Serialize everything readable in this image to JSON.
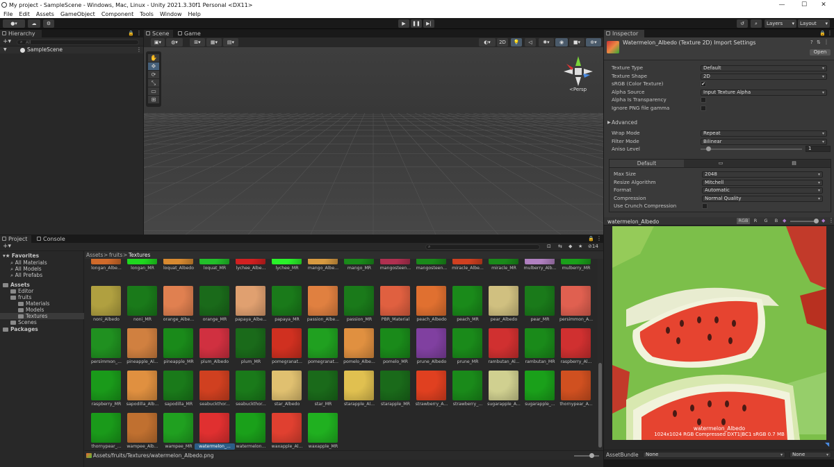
{
  "window": {
    "title": "My project - SampleScene - Windows, Mac, Linux - Unity 2021.3.30f1 Personal <DX11>",
    "minimize": "—",
    "maximize": "☐",
    "close": "✕"
  },
  "menu": [
    "File",
    "Edit",
    "Assets",
    "GameObject",
    "Component",
    "Tools",
    "Window",
    "Help"
  ],
  "toolbar": {
    "layers_label": "Layers",
    "layout_label": "Layout"
  },
  "hierarchy": {
    "tab": "Hierarchy",
    "search_placeholder": "All",
    "scene": "SampleScene"
  },
  "scene_view": {
    "tabs": [
      "Scene",
      "Game"
    ],
    "mode_2d": "2D",
    "persp_label": "<Persp"
  },
  "inspector": {
    "tab": "Inspector",
    "title": "Watermelon_Albedo (Texture 2D) Import Settings",
    "open_button": "Open",
    "rows": [
      {
        "label": "Texture Type",
        "value": "Default",
        "kind": "dropdown"
      },
      {
        "label": "Texture Shape",
        "value": "2D",
        "kind": "dropdown"
      },
      {
        "label": "sRGB (Color Texture)",
        "value": "✔",
        "kind": "check"
      },
      {
        "label": "Alpha Source",
        "value": "Input Texture Alpha",
        "kind": "dropdown"
      },
      {
        "label": "Alpha Is Transparency",
        "value": "",
        "kind": "check"
      },
      {
        "label": "Ignore PNG file gamma",
        "value": "",
        "kind": "check"
      }
    ],
    "advanced": "Advanced",
    "rows2": [
      {
        "label": "Wrap Mode",
        "value": "Repeat",
        "kind": "dropdown"
      },
      {
        "label": "Filter Mode",
        "value": "Bilinear",
        "kind": "dropdown"
      }
    ],
    "aniso": {
      "label": "Aniso Level",
      "value": "1"
    },
    "platform_tab": "Default",
    "platform_rows": [
      {
        "label": "Max Size",
        "value": "2048",
        "kind": "dropdown"
      },
      {
        "label": "Resize Algorithm",
        "value": "Mitchell",
        "kind": "dropdown"
      },
      {
        "label": "Format",
        "value": "Automatic",
        "kind": "dropdown"
      },
      {
        "label": "Compression",
        "value": "Normal Quality",
        "kind": "dropdown"
      },
      {
        "label": "Use Crunch Compression",
        "value": "",
        "kind": "check"
      }
    ],
    "preview": {
      "name": "watermelon_Albedo",
      "channels": [
        "RGB",
        "R",
        "G",
        "B"
      ],
      "caption": "watermelon_Albedo",
      "info": "1024x1024  RGB Compressed DXT1|BC1 sRGB  0.7 MB"
    },
    "assetbundle": {
      "label": "AssetBundle",
      "value": "None",
      "variant": "None"
    }
  },
  "project": {
    "tabs": [
      "Project",
      "Console"
    ],
    "tree": [
      {
        "label": "Favorites",
        "indent": 0,
        "kind": "star"
      },
      {
        "label": "All Materials",
        "indent": 1,
        "kind": "search"
      },
      {
        "label": "All Models",
        "indent": 1,
        "kind": "search"
      },
      {
        "label": "All Prefabs",
        "indent": 1,
        "kind": "search"
      },
      {
        "label": "Assets",
        "indent": 0,
        "kind": "folder"
      },
      {
        "label": "Editor",
        "indent": 1,
        "kind": "folder"
      },
      {
        "label": "fruits",
        "indent": 1,
        "kind": "folder"
      },
      {
        "label": "Materials",
        "indent": 2,
        "kind": "folder"
      },
      {
        "label": "Models",
        "indent": 2,
        "kind": "folder"
      },
      {
        "label": "Textures",
        "indent": 2,
        "kind": "folder",
        "selected": true
      },
      {
        "label": "Scenes",
        "indent": 1,
        "kind": "folder"
      },
      {
        "label": "Packages",
        "indent": 0,
        "kind": "folder"
      }
    ],
    "breadcrumb": [
      "Assets",
      ">",
      "fruits",
      ">",
      "Textures"
    ],
    "count": "14",
    "footer_path": "Assets/fruits/Textures/watermelon_Albedo.png",
    "assets": [
      [
        "longan_Albe...",
        "longan_MR",
        "loquat_Albedo",
        "loquat_MR",
        "lychee_Albe...",
        "lychee_MR",
        "mango_Albe...",
        "mango_MR",
        "mangosteen...",
        "mangosteen...",
        "miracle_Albe...",
        "miracle_MR",
        "mulberry_Alb...",
        "mulberry_MR"
      ],
      [
        "noni_Albedo",
        "noni_MR",
        "orange_Albe...",
        "orange_MR",
        "papaya_Albe...",
        "papaya_MR",
        "passion_Albe...",
        "passion_MR",
        "PBR_Material",
        "peach_Albedo",
        "peach_MR",
        "pear_Albedo",
        "pear_MR",
        "persimmon_A..."
      ],
      [
        "persimmon_...",
        "pineapple_Al...",
        "pineapple_MR",
        "plum_Albedo",
        "plum_MR",
        "pomegranat...",
        "pomegranat...",
        "pomelo_Albe...",
        "pomelo_MR",
        "prune_Albedo",
        "prune_MR",
        "rambutan_Al...",
        "rambutan_MR",
        "raspberry_Al..."
      ],
      [
        "raspberry_MR",
        "sapodilla_Alb...",
        "sapodilla_MR",
        "seabuckthor...",
        "seabuckthor...",
        "star_Albedo",
        "star_MR",
        "starapple_Al...",
        "starapple_MR",
        "strawberry_A...",
        "strawberry_...",
        "sugarapple_A...",
        "sugarapple_...",
        "thornypear_A..."
      ],
      [
        "thornypear_...",
        "wampee_Alb...",
        "wampee_MR",
        "watermelon_...",
        "watermelon...",
        "waxapple_Al...",
        "waxapple_MR"
      ]
    ],
    "colors": [
      [
        "#d06a2a",
        "#1fd81f",
        "#d88a30",
        "#22c02a",
        "#d22020",
        "#2af22a",
        "#d89a40",
        "#1a8a1a",
        "#b03050",
        "#1a8a1a",
        "#d04020",
        "#1a8a1a",
        "#b080c0",
        "#1aa01a"
      ],
      [
        "#b0a040",
        "#1a7a1a",
        "#e08050",
        "#1a6a1a",
        "#e0a070",
        "#1a7a1a",
        "#e08040",
        "#1a7a1a",
        "#e06040",
        "#e07030",
        "#1a8a1a",
        "#d0c080",
        "#1a7a1a",
        "#e06050"
      ],
      [
        "#209020",
        "#d08040",
        "#1a8a1a",
        "#d03040",
        "#1a6a1a",
        "#d03020",
        "#20a020",
        "#e09040",
        "#1a8a1a",
        "#8040a0",
        "#1a8a1a",
        "#d03030",
        "#1a8a1a",
        "#d03030"
      ],
      [
        "#1a9a1a",
        "#e09040",
        "#1a7a1a",
        "#d04020",
        "#1a7a1a",
        "#e0c070",
        "#1a6a1a",
        "#e0c050",
        "#1a6a1a",
        "#e04020",
        "#1a8a1a",
        "#d0d090",
        "#1aa01a",
        "#d05020"
      ],
      [
        "#1a9a1a",
        "#c07030",
        "#20a020",
        "#e03030",
        "#1aa01a",
        "#e04030",
        "#20b020"
      ]
    ],
    "selected": "watermelon_..."
  }
}
